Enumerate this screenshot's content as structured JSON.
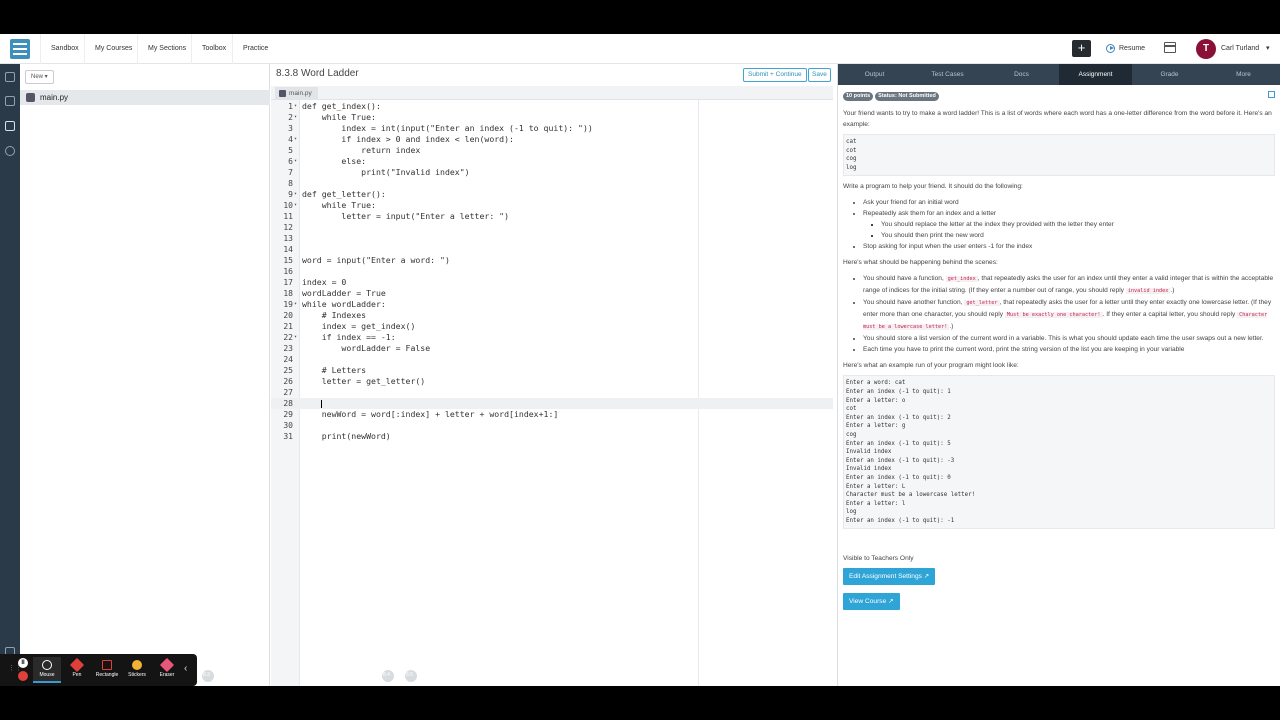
{
  "topnav": {
    "links": [
      "Sandbox",
      "My Courses",
      "My Sections",
      "Toolbox",
      "Practice"
    ],
    "plus": "+",
    "resume": "Resume",
    "user_initial": "T",
    "user_name": "Carl Turland",
    "user_chevron": "▾"
  },
  "files": {
    "new_label": "New ▾",
    "items": [
      "main.py"
    ]
  },
  "editor": {
    "title": "8.3.8 Word Ladder",
    "submit": "Submit + Continue",
    "save": "Save",
    "tab": "main.py",
    "lines": [
      {
        "n": "1",
        "t": "def get_index():",
        "f": "▾"
      },
      {
        "n": "2",
        "t": "    while True:",
        "f": "▾"
      },
      {
        "n": "3",
        "t": "        index = int(input(\"Enter an index (-1 to quit): \"))",
        "f": ""
      },
      {
        "n": "4",
        "t": "        if index > 0 and index < len(word):",
        "f": "▾"
      },
      {
        "n": "5",
        "t": "            return index",
        "f": ""
      },
      {
        "n": "6",
        "t": "        else:",
        "f": "▾"
      },
      {
        "n": "7",
        "t": "            print(\"Invalid index\")",
        "f": ""
      },
      {
        "n": "8",
        "t": "",
        "f": ""
      },
      {
        "n": "9",
        "t": "def get_letter():",
        "f": "▾"
      },
      {
        "n": "10",
        "t": "    while True:",
        "f": "▾"
      },
      {
        "n": "11",
        "t": "        letter = input(\"Enter a letter: \")",
        "f": ""
      },
      {
        "n": "12",
        "t": "",
        "f": ""
      },
      {
        "n": "13",
        "t": "",
        "f": ""
      },
      {
        "n": "14",
        "t": "",
        "f": ""
      },
      {
        "n": "15",
        "t": "word = input(\"Enter a word: \")",
        "f": ""
      },
      {
        "n": "16",
        "t": "",
        "f": ""
      },
      {
        "n": "17",
        "t": "index = 0",
        "f": ""
      },
      {
        "n": "18",
        "t": "wordLadder = True",
        "f": ""
      },
      {
        "n": "19",
        "t": "while wordLadder:",
        "f": "▾"
      },
      {
        "n": "20",
        "t": "    # Indexes",
        "f": ""
      },
      {
        "n": "21",
        "t": "    index = get_index()",
        "f": ""
      },
      {
        "n": "22",
        "t": "    if index == -1:",
        "f": "▾"
      },
      {
        "n": "23",
        "t": "        wordLadder = False",
        "f": ""
      },
      {
        "n": "24",
        "t": "",
        "f": ""
      },
      {
        "n": "25",
        "t": "    # Letters",
        "f": ""
      },
      {
        "n": "26",
        "t": "    letter = get_letter()",
        "f": ""
      },
      {
        "n": "27",
        "t": "",
        "f": ""
      },
      {
        "n": "28",
        "t": "    ",
        "f": ""
      },
      {
        "n": "29",
        "t": "    newWord = word[:index] + letter + word[index+1:]",
        "f": ""
      },
      {
        "n": "30",
        "t": "",
        "f": ""
      },
      {
        "n": "31",
        "t": "    print(newWord)",
        "f": ""
      }
    ],
    "active_line_index": 27
  },
  "right_panel": {
    "tabs": [
      "Output",
      "Test Cases",
      "Docs",
      "Assignment",
      "Grade",
      "More"
    ],
    "active_tab": "Assignment",
    "badges": [
      "10 points",
      "Status: Not Submitted"
    ],
    "intro": "Your friend wants to try to make a word ladder! This is a list of words where each word has a one-letter difference from the word before it. Here's an example:",
    "example_words": "cat\ncot\ncog\nlog",
    "task_intro": "Write a program to help your friend. It should do the following:",
    "task_items": [
      "Ask your friend for an initial word",
      "Repeatedly ask them for an index and a letter",
      "Stop asking for input when the user enters -1 for the index"
    ],
    "task_subitems": [
      "You should replace the letter at the index they provided with the letter they enter",
      "You should then print the new word"
    ],
    "behind_intro": "Here's what should be happening behind the scenes:",
    "behind": {
      "b1_a": "You should have a function, ",
      "b1_code": "get_index",
      "b1_b": ", that repeatedly asks the user for an index until they enter a valid integer that is within the acceptable range of indices for the initial string. (If they enter a number out of range, you should reply ",
      "b1_code2": "invalid index",
      "b1_c": ".)",
      "b2_a": "You should have another function, ",
      "b2_code": "get_letter",
      "b2_b": ", that repeatedly asks the user for a letter until they enter exactly one lowercase letter. (If they enter more than one character, you should reply ",
      "b2_code2": "Must be exactly one character!",
      "b2_c": ". If they enter a capital letter, you should reply ",
      "b2_code3": "Character must be a lowercase letter!",
      "b2_d": ".)",
      "b3": "You should store a list version of the current word in a variable. This is what you should update each time the user swaps out a new letter.",
      "b4": "Each time you have to print the current word, print the string version of the list you are keeping in your variable"
    },
    "run_intro": "Here's what an example run of your program might look like:",
    "example_run": "Enter a word: cat\nEnter an index (-1 to quit): 1\nEnter a letter: o\ncot\nEnter an index (-1 to quit): 2\nEnter a letter: g\ncog\nEnter an index (-1 to quit): 5\nInvalid index\nEnter an index (-1 to quit): -3\nInvalid index\nEnter an index (-1 to quit): 0\nEnter a letter: L\nCharacter must be a lowercase letter!\nEnter a letter: l\nlog\nEnter an index (-1 to quit): -1",
    "teachers_label": "Visible to Teachers Only",
    "edit_settings": "Edit Assignment Settings ↗",
    "view_course": "View Course ↗"
  },
  "toolbar": {
    "pause": "II",
    "collapse": "‹",
    "tools": [
      {
        "label": "Mouse",
        "color": "#ffffff"
      },
      {
        "label": "Pen",
        "color": "#e0403a"
      },
      {
        "label": "Rectangle",
        "color": "#e0403a"
      },
      {
        "label": "Stickers",
        "color": "#f2b233"
      },
      {
        "label": "Eraser",
        "color": "#e8577a"
      }
    ]
  },
  "ghost_bar": [
    "8.3",
    "8.4",
    "8.5"
  ]
}
